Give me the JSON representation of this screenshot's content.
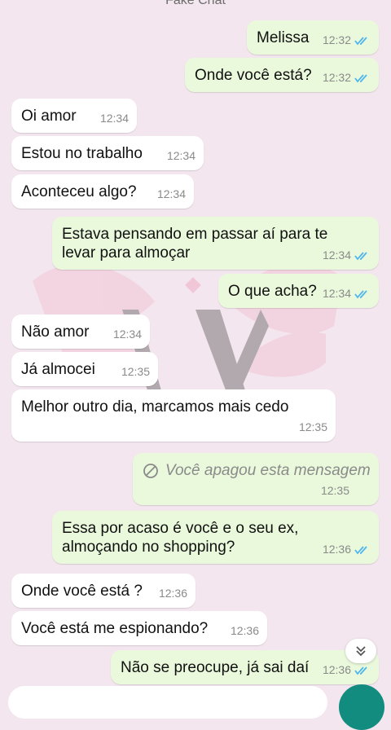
{
  "header": {
    "title": "Fake Chat"
  },
  "messages": [
    {
      "dir": "out",
      "text": "Melissa",
      "time": "12:32",
      "ticks": true
    },
    {
      "dir": "out",
      "text": "Onde você está?",
      "time": "12:32",
      "ticks": true
    },
    {
      "dir": "in",
      "text": "Oi amor",
      "time": "12:34"
    },
    {
      "dir": "in",
      "text": "Estou no trabalho",
      "time": "12:34"
    },
    {
      "dir": "in",
      "text": "Aconteceu algo?",
      "time": "12:34"
    },
    {
      "dir": "out",
      "text": "Estava pensando em passar aí para te levar para almoçar",
      "time": "12:34",
      "ticks": true
    },
    {
      "dir": "out",
      "text": "O que acha?",
      "time": "12:34",
      "ticks": true
    },
    {
      "dir": "in",
      "text": "Não amor",
      "time": "12:34"
    },
    {
      "dir": "in",
      "text": "Já almocei",
      "time": "12:35"
    },
    {
      "dir": "in",
      "text": "Melhor outro dia, marcamos mais cedo",
      "time": "12:35"
    },
    {
      "dir": "out",
      "text": "Você apagou esta mensagem",
      "time": "12:35",
      "deleted": true
    },
    {
      "dir": "out",
      "text": "Essa por acaso é você e o seu ex, almoçando no shopping?",
      "time": "12:36",
      "ticks": true
    },
    {
      "dir": "in",
      "text": "Onde você está ?",
      "time": "12:36"
    },
    {
      "dir": "in",
      "text": "Você está me espionando?",
      "time": "12:36"
    },
    {
      "dir": "out",
      "text": "Não se preocupe, já sai daí",
      "time": "12:36",
      "ticks": true
    }
  ],
  "colors": {
    "outgoing": "#eaf9dc",
    "incoming": "#ffffff",
    "ticks": "#4fb6ec",
    "fab": "#128c7e"
  },
  "icons": {
    "scroll": "double-chevron-down-icon",
    "deleted": "prohibited-icon",
    "read": "double-check-icon"
  }
}
